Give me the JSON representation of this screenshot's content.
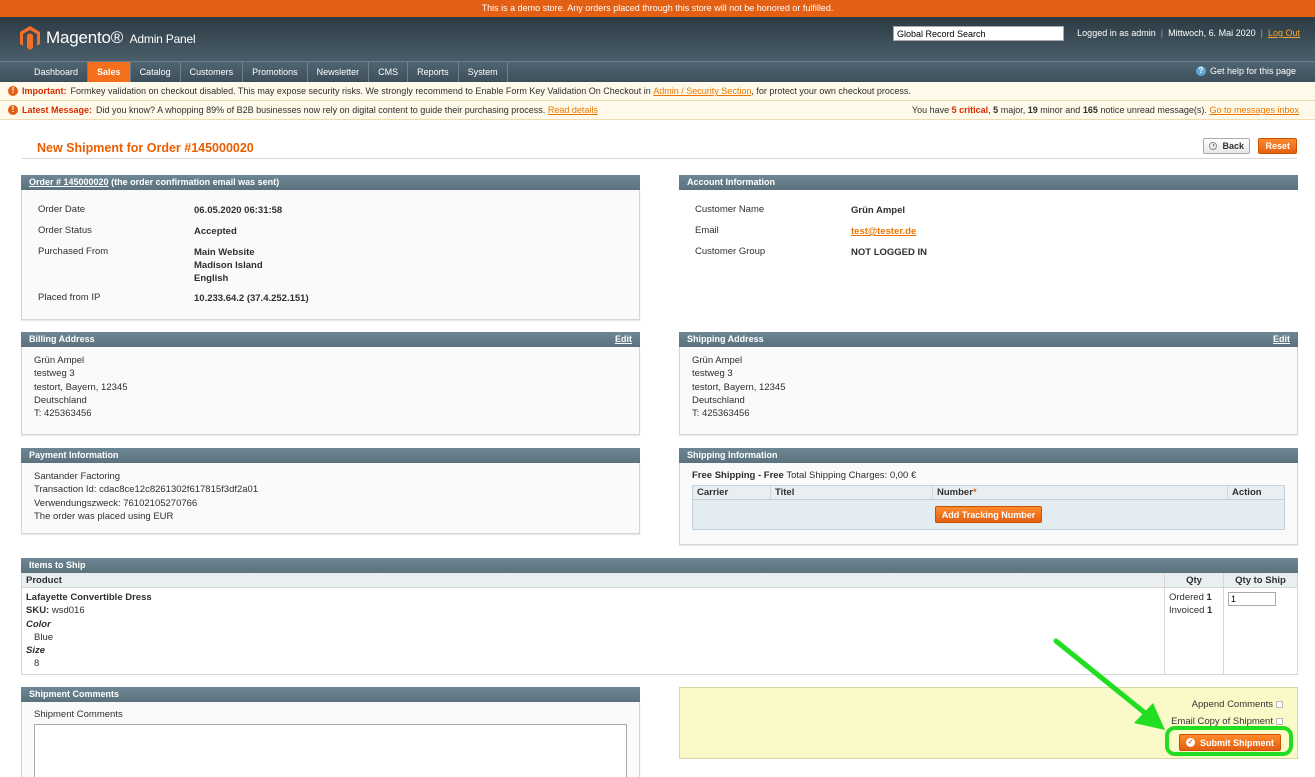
{
  "demo_notice": "This is a demo store. Any orders placed through this store will not be honored or fulfilled.",
  "header": {
    "logo_brand": "Magento",
    "logo_sub": "Admin Panel",
    "search_value": "Global Record Search",
    "logged_in": "Logged in as admin",
    "date": "Mittwoch, 6. Mai 2020",
    "logout": "Log Out"
  },
  "nav": {
    "items": [
      "Dashboard",
      "Sales",
      "Catalog",
      "Customers",
      "Promotions",
      "Newsletter",
      "CMS",
      "Reports",
      "System"
    ],
    "help": "Get help for this page"
  },
  "notices": {
    "important_label": "Important:",
    "important_text": "Formkey validation on checkout disabled. This may expose security risks. We strongly recommend to Enable Form Key Validation On Checkout in",
    "important_link": "Admin / Security Section",
    "important_tail": ", for protect your own checkout process.",
    "latest_label": "Latest Message:",
    "latest_text": "Did you know? A whopping 89% of B2B businesses now rely on digital content to guide their purchasing process.",
    "latest_link": "Read details",
    "msg_prefix": "You have",
    "msg_critical": "5 critical",
    "msg_major_num": "5",
    "msg_major": "major,",
    "msg_minor_num": "19",
    "msg_minor": "minor and",
    "msg_notice_num": "165",
    "msg_notice": "notice unread message(s).",
    "msg_link": "Go to messages inbox"
  },
  "page": {
    "title": "New Shipment for Order #145000020",
    "back": "Back",
    "reset": "Reset"
  },
  "order_box": {
    "order_link": "Order # 145000020",
    "header_tail": "(the order confirmation email was sent)",
    "rows": [
      {
        "label": "Order Date",
        "value": "06.05.2020 06:31:58"
      },
      {
        "label": "Order Status",
        "value": "Accepted"
      },
      {
        "label": "Purchased From",
        "value_lines": [
          "Main Website",
          "Madison Island",
          "English"
        ]
      },
      {
        "label": "Placed from IP",
        "value": "10.233.64.2 (37.4.252.151)"
      }
    ]
  },
  "account_box": {
    "title": "Account Information",
    "name_label": "Customer Name",
    "name_value": "Grün Ampel",
    "email_label": "Email",
    "email_value": "test@tester.de",
    "group_label": "Customer Group",
    "group_value": "NOT LOGGED IN"
  },
  "billing": {
    "title": "Billing Address",
    "edit": "Edit",
    "lines": [
      "Grün Ampel",
      "testweg 3",
      "testort, Bayern, 12345",
      "Deutschland",
      "T: 425363456"
    ]
  },
  "shipping": {
    "title": "Shipping Address",
    "edit": "Edit",
    "lines": [
      "Grün Ampel",
      "testweg 3",
      "testort, Bayern, 12345",
      "Deutschland",
      "T: 425363456"
    ]
  },
  "payment": {
    "title": "Payment Information",
    "lines": [
      "Santander Factoring",
      "Transaction Id: cdac8ce12c8261302f617815f3df2a01",
      "Verwendungszweck: 76102105270766",
      "The order was placed using EUR"
    ]
  },
  "shipping_info": {
    "title": "Shipping Information",
    "method": "Free Shipping - Free",
    "charges": "Total Shipping Charges: 0,00 €",
    "cols": [
      "Carrier",
      "Titel",
      "Number",
      "Action"
    ],
    "required_mark": "*",
    "add_tracking": "Add Tracking Number"
  },
  "items": {
    "title": "Items to Ship",
    "cols": [
      "Product",
      "Qty",
      "Qty to Ship"
    ],
    "product_name": "Lafayette Convertible Dress",
    "sku_label": "SKU:",
    "sku": "wsd016",
    "color_label": "Color",
    "color": "Blue",
    "size_label": "Size",
    "size": "8",
    "ordered_label": "Ordered",
    "ordered": "1",
    "invoiced_label": "Invoiced",
    "invoiced": "1",
    "qty_to_ship": "1"
  },
  "comments": {
    "title": "Shipment Comments",
    "label": "Shipment Comments"
  },
  "submit": {
    "append": "Append Comments",
    "email_copy": "Email Copy of Shipment",
    "button": "Submit Shipment"
  }
}
